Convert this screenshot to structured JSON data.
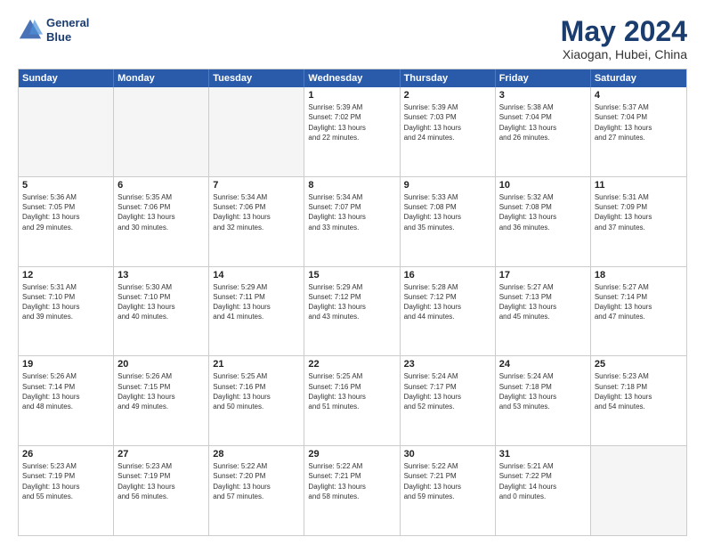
{
  "header": {
    "logo_line1": "General",
    "logo_line2": "Blue",
    "title": "May 2024",
    "subtitle": "Xiaogan, Hubei, China"
  },
  "weekdays": [
    "Sunday",
    "Monday",
    "Tuesday",
    "Wednesday",
    "Thursday",
    "Friday",
    "Saturday"
  ],
  "rows": [
    [
      {
        "day": "",
        "detail": ""
      },
      {
        "day": "",
        "detail": ""
      },
      {
        "day": "",
        "detail": ""
      },
      {
        "day": "1",
        "detail": "Sunrise: 5:39 AM\nSunset: 7:02 PM\nDaylight: 13 hours\nand 22 minutes."
      },
      {
        "day": "2",
        "detail": "Sunrise: 5:39 AM\nSunset: 7:03 PM\nDaylight: 13 hours\nand 24 minutes."
      },
      {
        "day": "3",
        "detail": "Sunrise: 5:38 AM\nSunset: 7:04 PM\nDaylight: 13 hours\nand 26 minutes."
      },
      {
        "day": "4",
        "detail": "Sunrise: 5:37 AM\nSunset: 7:04 PM\nDaylight: 13 hours\nand 27 minutes."
      }
    ],
    [
      {
        "day": "5",
        "detail": "Sunrise: 5:36 AM\nSunset: 7:05 PM\nDaylight: 13 hours\nand 29 minutes."
      },
      {
        "day": "6",
        "detail": "Sunrise: 5:35 AM\nSunset: 7:06 PM\nDaylight: 13 hours\nand 30 minutes."
      },
      {
        "day": "7",
        "detail": "Sunrise: 5:34 AM\nSunset: 7:06 PM\nDaylight: 13 hours\nand 32 minutes."
      },
      {
        "day": "8",
        "detail": "Sunrise: 5:34 AM\nSunset: 7:07 PM\nDaylight: 13 hours\nand 33 minutes."
      },
      {
        "day": "9",
        "detail": "Sunrise: 5:33 AM\nSunset: 7:08 PM\nDaylight: 13 hours\nand 35 minutes."
      },
      {
        "day": "10",
        "detail": "Sunrise: 5:32 AM\nSunset: 7:08 PM\nDaylight: 13 hours\nand 36 minutes."
      },
      {
        "day": "11",
        "detail": "Sunrise: 5:31 AM\nSunset: 7:09 PM\nDaylight: 13 hours\nand 37 minutes."
      }
    ],
    [
      {
        "day": "12",
        "detail": "Sunrise: 5:31 AM\nSunset: 7:10 PM\nDaylight: 13 hours\nand 39 minutes."
      },
      {
        "day": "13",
        "detail": "Sunrise: 5:30 AM\nSunset: 7:10 PM\nDaylight: 13 hours\nand 40 minutes."
      },
      {
        "day": "14",
        "detail": "Sunrise: 5:29 AM\nSunset: 7:11 PM\nDaylight: 13 hours\nand 41 minutes."
      },
      {
        "day": "15",
        "detail": "Sunrise: 5:29 AM\nSunset: 7:12 PM\nDaylight: 13 hours\nand 43 minutes."
      },
      {
        "day": "16",
        "detail": "Sunrise: 5:28 AM\nSunset: 7:12 PM\nDaylight: 13 hours\nand 44 minutes."
      },
      {
        "day": "17",
        "detail": "Sunrise: 5:27 AM\nSunset: 7:13 PM\nDaylight: 13 hours\nand 45 minutes."
      },
      {
        "day": "18",
        "detail": "Sunrise: 5:27 AM\nSunset: 7:14 PM\nDaylight: 13 hours\nand 47 minutes."
      }
    ],
    [
      {
        "day": "19",
        "detail": "Sunrise: 5:26 AM\nSunset: 7:14 PM\nDaylight: 13 hours\nand 48 minutes."
      },
      {
        "day": "20",
        "detail": "Sunrise: 5:26 AM\nSunset: 7:15 PM\nDaylight: 13 hours\nand 49 minutes."
      },
      {
        "day": "21",
        "detail": "Sunrise: 5:25 AM\nSunset: 7:16 PM\nDaylight: 13 hours\nand 50 minutes."
      },
      {
        "day": "22",
        "detail": "Sunrise: 5:25 AM\nSunset: 7:16 PM\nDaylight: 13 hours\nand 51 minutes."
      },
      {
        "day": "23",
        "detail": "Sunrise: 5:24 AM\nSunset: 7:17 PM\nDaylight: 13 hours\nand 52 minutes."
      },
      {
        "day": "24",
        "detail": "Sunrise: 5:24 AM\nSunset: 7:18 PM\nDaylight: 13 hours\nand 53 minutes."
      },
      {
        "day": "25",
        "detail": "Sunrise: 5:23 AM\nSunset: 7:18 PM\nDaylight: 13 hours\nand 54 minutes."
      }
    ],
    [
      {
        "day": "26",
        "detail": "Sunrise: 5:23 AM\nSunset: 7:19 PM\nDaylight: 13 hours\nand 55 minutes."
      },
      {
        "day": "27",
        "detail": "Sunrise: 5:23 AM\nSunset: 7:19 PM\nDaylight: 13 hours\nand 56 minutes."
      },
      {
        "day": "28",
        "detail": "Sunrise: 5:22 AM\nSunset: 7:20 PM\nDaylight: 13 hours\nand 57 minutes."
      },
      {
        "day": "29",
        "detail": "Sunrise: 5:22 AM\nSunset: 7:21 PM\nDaylight: 13 hours\nand 58 minutes."
      },
      {
        "day": "30",
        "detail": "Sunrise: 5:22 AM\nSunset: 7:21 PM\nDaylight: 13 hours\nand 59 minutes."
      },
      {
        "day": "31",
        "detail": "Sunrise: 5:21 AM\nSunset: 7:22 PM\nDaylight: 14 hours\nand 0 minutes."
      },
      {
        "day": "",
        "detail": ""
      }
    ]
  ]
}
